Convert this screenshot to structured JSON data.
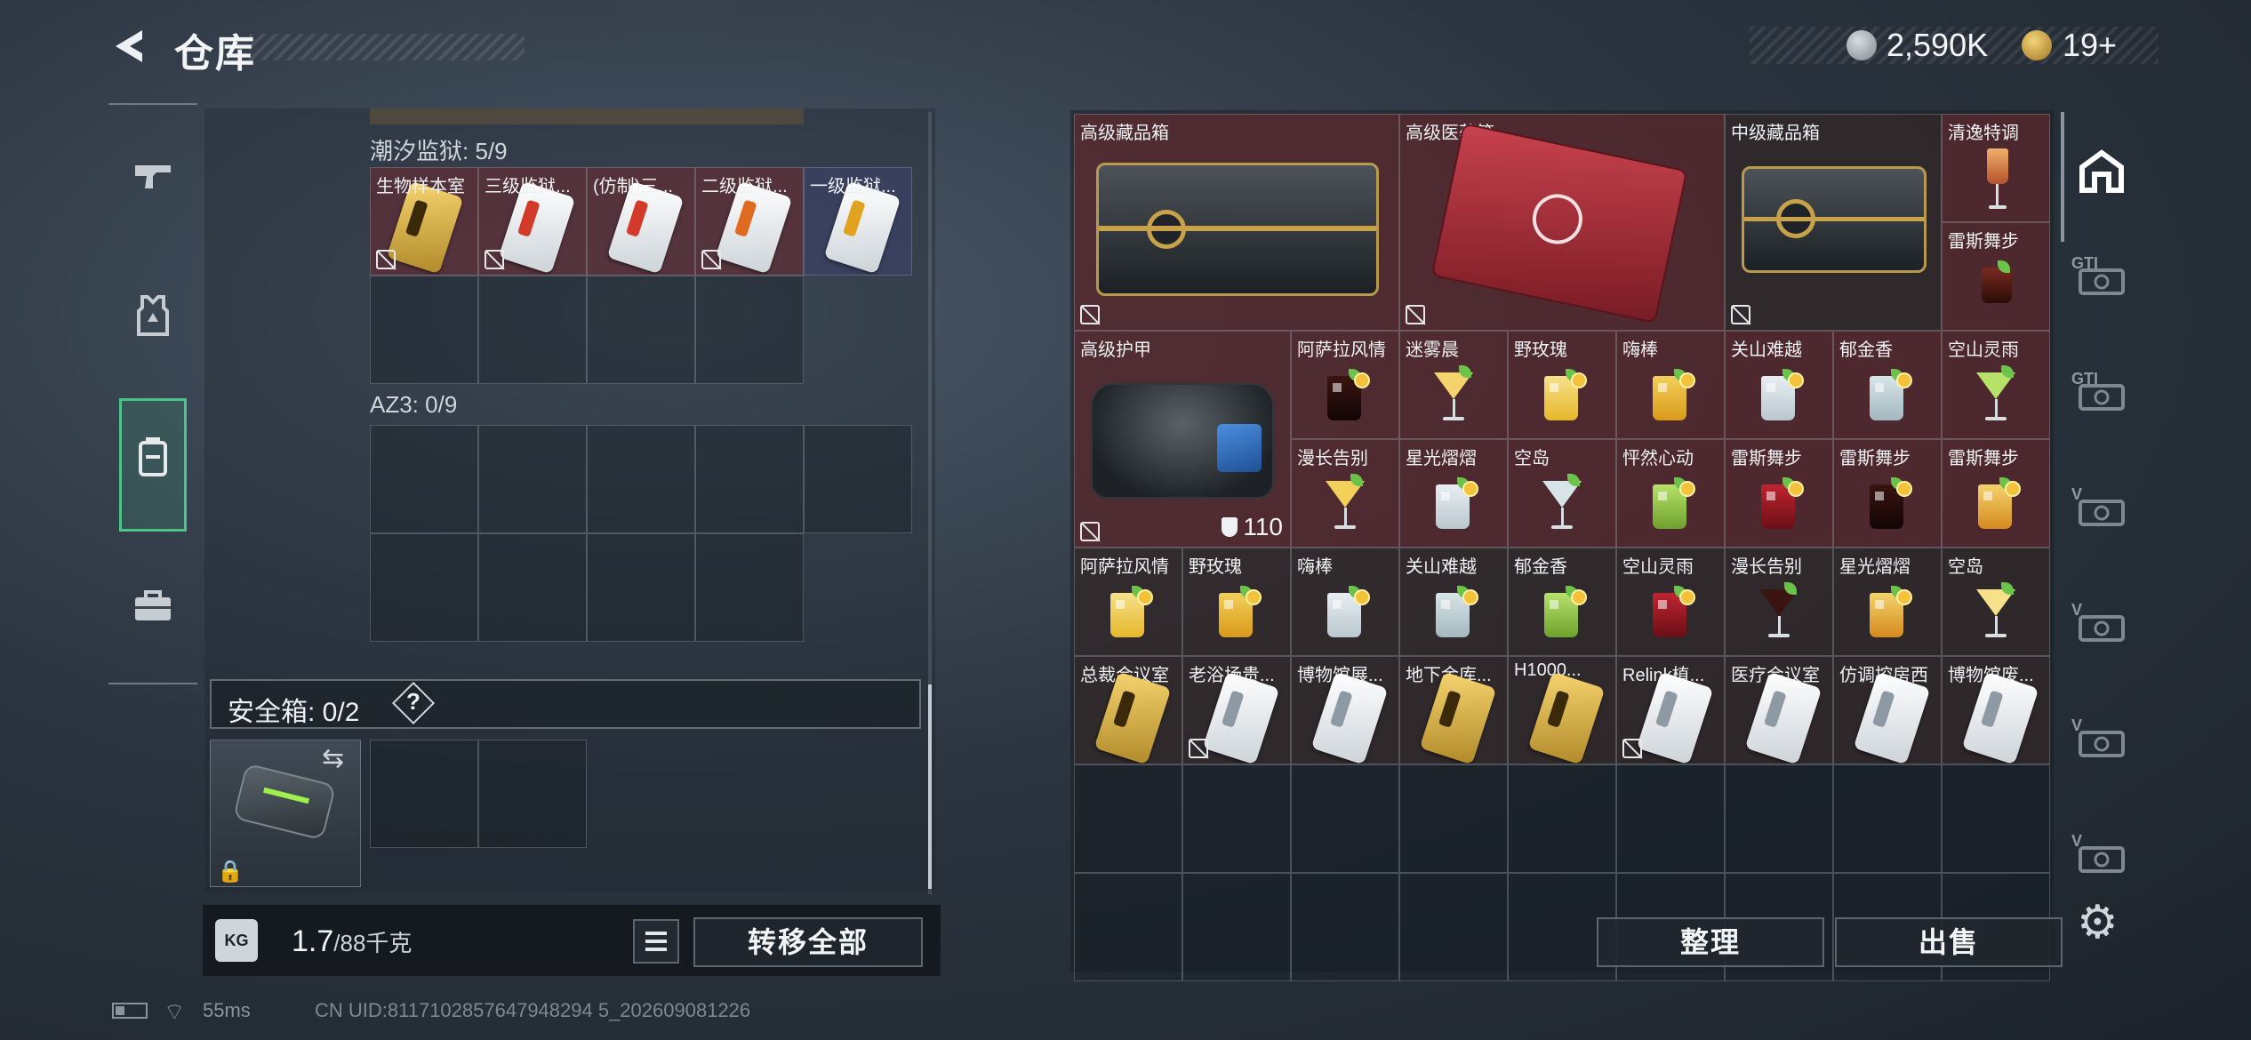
{
  "header": {
    "title": "仓库",
    "currency": [
      {
        "name": "silver-coin-icon",
        "value": "2,590K"
      },
      {
        "name": "gold-coin-icon",
        "value": "19+"
      }
    ]
  },
  "left_tabs": [
    {
      "icon": "pistol-icon"
    },
    {
      "icon": "vest-icon"
    },
    {
      "icon": "backpack-icon",
      "active": true
    },
    {
      "icon": "briefcase-icon"
    }
  ],
  "containers": {
    "section1": {
      "label": "潮汐监狱: 5/9",
      "items": [
        "生物样本室",
        "三级监狱...",
        "(仿制)三...",
        "二级监狱...",
        "一级监狱..."
      ]
    },
    "section2": {
      "label": "AZ3: 0/9"
    },
    "safe_box": {
      "label": "安全箱: 0/2",
      "help": "?"
    }
  },
  "weight": {
    "current": "1.7",
    "max": "/88千克",
    "unit_icon": "KG"
  },
  "buttons": {
    "transfer_all": "转移全部",
    "sort": "整理",
    "sell": "出售"
  },
  "status": {
    "ping": "55ms",
    "uid": "CN UID:8117102857647948294 5_202609081226"
  },
  "stash": {
    "big_items": [
      "高级藏品箱",
      "高级医药箱",
      "中级藏品箱",
      "高级护甲"
    ],
    "armor_value": "110",
    "side_items": [
      "清逸特调",
      "雷斯舞步"
    ],
    "row1": [
      "阿萨拉风情",
      "迷雾晨",
      "野玫瑰",
      "嗨棒",
      "关山难越",
      "郁金香",
      "空山灵雨"
    ],
    "row2": [
      "漫长告别",
      "星光熠熠",
      "空岛",
      "怦然心动",
      "雷斯舞步",
      "雷斯舞步",
      "雷斯舞步"
    ],
    "row3": [
      "阿萨拉风情",
      "野玫瑰",
      "嗨棒",
      "关山难越",
      "郁金香",
      "空山灵雨",
      "漫长告别",
      "星光熠熠",
      "空岛"
    ],
    "row4": [
      "总裁会议室",
      "老浴场贵...",
      "博物馆展...",
      "地下金库...",
      "H1000...",
      "Relink植...",
      "医疗会议室",
      "仿调控房西",
      "博物馆废..."
    ]
  },
  "right_rail": [
    "safe-house-icon",
    "GTI",
    "GTI",
    "V",
    "V",
    "V",
    "V"
  ]
}
